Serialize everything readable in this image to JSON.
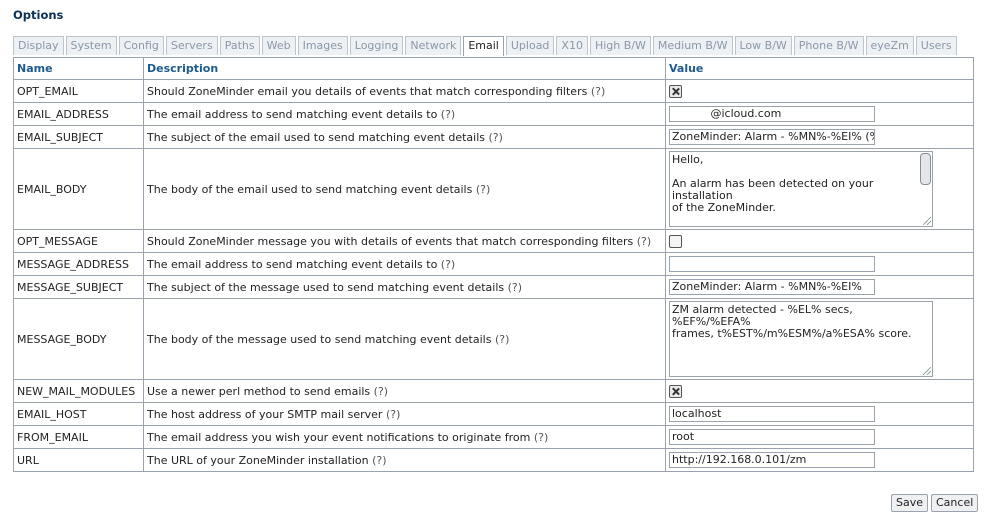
{
  "page": {
    "title": "Options"
  },
  "tabs": [
    {
      "label": "Display",
      "active": false
    },
    {
      "label": "System",
      "active": false
    },
    {
      "label": "Config",
      "active": false
    },
    {
      "label": "Servers",
      "active": false
    },
    {
      "label": "Paths",
      "active": false
    },
    {
      "label": "Web",
      "active": false
    },
    {
      "label": "Images",
      "active": false
    },
    {
      "label": "Logging",
      "active": false
    },
    {
      "label": "Network",
      "active": false
    },
    {
      "label": "Email",
      "active": true
    },
    {
      "label": "Upload",
      "active": false
    },
    {
      "label": "X10",
      "active": false
    },
    {
      "label": "High B/W",
      "active": false
    },
    {
      "label": "Medium B/W",
      "active": false
    },
    {
      "label": "Low B/W",
      "active": false
    },
    {
      "label": "Phone B/W",
      "active": false
    },
    {
      "label": "eyeZm",
      "active": false
    },
    {
      "label": "Users",
      "active": false
    }
  ],
  "table": {
    "headers": {
      "name": "Name",
      "description": "Description",
      "value": "Value"
    },
    "rows": [
      {
        "name": "OPT_EMAIL",
        "description": "Should ZoneMinder email you details of events that match corresponding filters",
        "help": "(?)",
        "control": "checkbox",
        "checked": true
      },
      {
        "name": "EMAIL_ADDRESS",
        "description": "The email address to send matching event details to",
        "help": "(?)",
        "control": "text",
        "value": "           @icloud.com"
      },
      {
        "name": "EMAIL_SUBJECT",
        "description": "The subject of the email used to send matching event details",
        "help": "(?)",
        "control": "text",
        "value": "ZoneMinder: Alarm - %MN%-%EI% (%"
      },
      {
        "name": "EMAIL_BODY",
        "description": "The body of the email used to send matching event details",
        "help": "(?)",
        "control": "textarea",
        "value": "Hello,\n\nAn alarm has been detected on your installation\nof the ZoneMinder.\n\nThe details are as follows :-"
      },
      {
        "name": "OPT_MESSAGE",
        "description": "Should ZoneMinder message you with details of events that match corresponding filters",
        "help": "(?)",
        "control": "checkbox",
        "checked": false
      },
      {
        "name": "MESSAGE_ADDRESS",
        "description": "The email address to send matching event details to",
        "help": "(?)",
        "control": "text",
        "value": ""
      },
      {
        "name": "MESSAGE_SUBJECT",
        "description": "The subject of the message used to send matching event details",
        "help": "(?)",
        "control": "text",
        "value": "ZoneMinder: Alarm - %MN%-%EI%"
      },
      {
        "name": "MESSAGE_BODY",
        "description": "The body of the message used to send matching event details",
        "help": "(?)",
        "control": "textarea",
        "value": "ZM alarm detected - %EL% secs, %EF%/%EFA%\nframes, t%EST%/m%ESM%/a%ESA% score."
      },
      {
        "name": "NEW_MAIL_MODULES",
        "description": "Use a newer perl method to send emails",
        "help": "(?)",
        "control": "checkbox",
        "checked": true
      },
      {
        "name": "EMAIL_HOST",
        "description": "The host address of your SMTP mail server",
        "help": "(?)",
        "control": "text",
        "value": "localhost"
      },
      {
        "name": "FROM_EMAIL",
        "description": "The email address you wish your event notifications to originate from",
        "help": "(?)",
        "control": "text",
        "value": "root"
      },
      {
        "name": "URL",
        "description": "The URL of your ZoneMinder installation",
        "help": "(?)",
        "control": "text",
        "value": "http://192.168.0.101/zm"
      }
    ]
  },
  "buttons": {
    "save": "Save",
    "cancel": "Cancel"
  }
}
